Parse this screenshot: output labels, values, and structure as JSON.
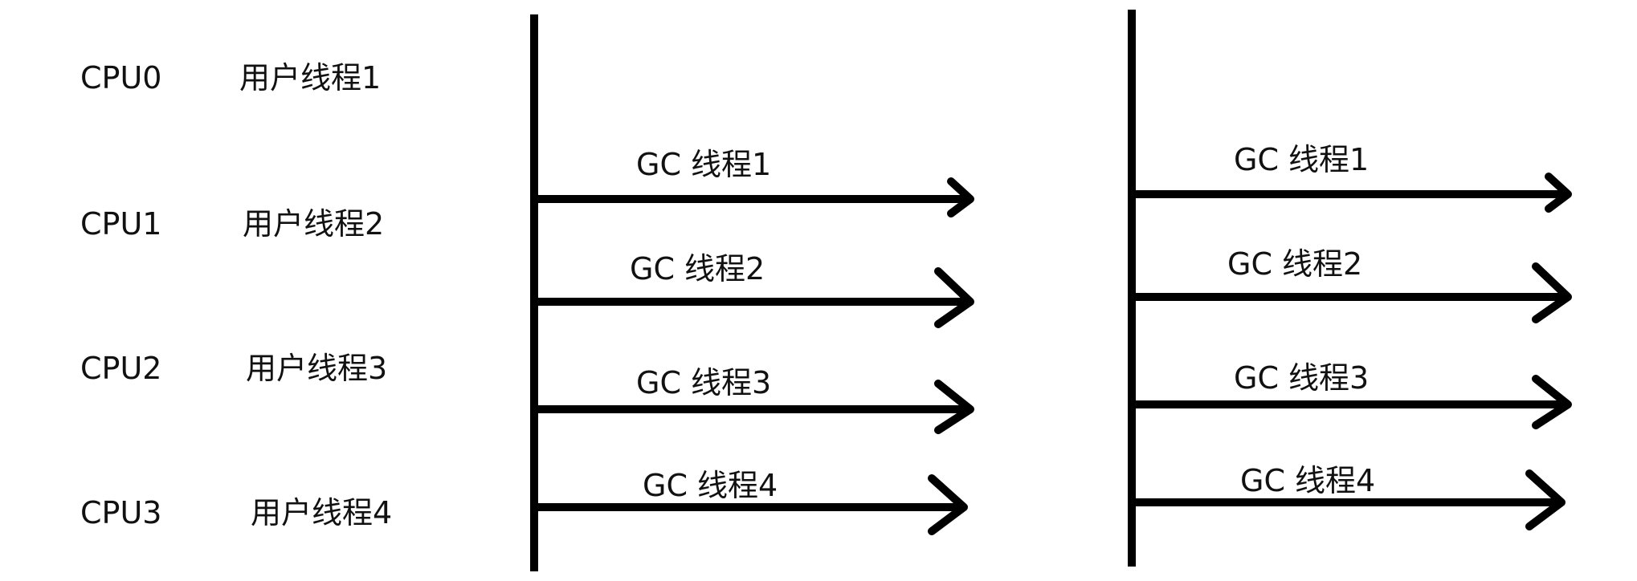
{
  "cpus": [
    {
      "cpu": "CPU0",
      "user_thread": "用户线程1"
    },
    {
      "cpu": "CPU1",
      "user_thread": "用户线程2"
    },
    {
      "cpu": "CPU2",
      "user_thread": "用户线程3"
    },
    {
      "cpu": "CPU3",
      "user_thread": "用户线程4"
    }
  ],
  "gc_phases": [
    {
      "threads": [
        "GC 线程1",
        "GC 线程2",
        "GC 线程3",
        "GC 线程4"
      ]
    },
    {
      "threads": [
        "GC 线程1",
        "GC 线程2",
        "GC 线程3",
        "GC 线程4"
      ]
    }
  ],
  "colors": {
    "ink": "#000000",
    "text": "#111111",
    "background": "#ffffff"
  }
}
